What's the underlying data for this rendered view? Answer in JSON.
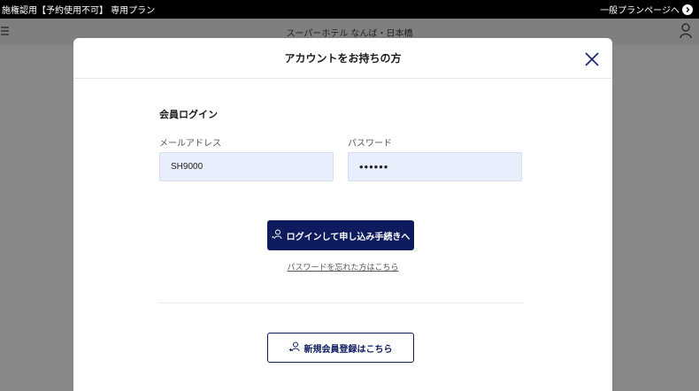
{
  "topbar": {
    "notice": "施権認用【予約使用不可】 専用プラン",
    "link_label": "一般プランページへ"
  },
  "header": {
    "hotel_name": "スーパーホテル なんば・日本橋"
  },
  "modal": {
    "title": "アカウントをお持ちの方",
    "section_title": "会員ログイン",
    "email_label": "メールアドレス",
    "email_value": "SH9000",
    "password_label": "パスワード",
    "password_value": "••••••",
    "login_button": "ログインして申し込み手続きへ",
    "forgot_link": "パスワードを忘れた方はこちら",
    "register_button": "新規会員登録はこちら"
  },
  "icons": {
    "menu": "hamburger-icon",
    "user": "user-icon",
    "close": "close-icon",
    "arrow": "arrow-right-icon",
    "login": "user-login-icon",
    "register": "user-add-icon"
  },
  "colors": {
    "primary": "#0e1b5e",
    "topbar": "#000000",
    "field_bg": "#e8eefb",
    "overlay": "#878787"
  }
}
